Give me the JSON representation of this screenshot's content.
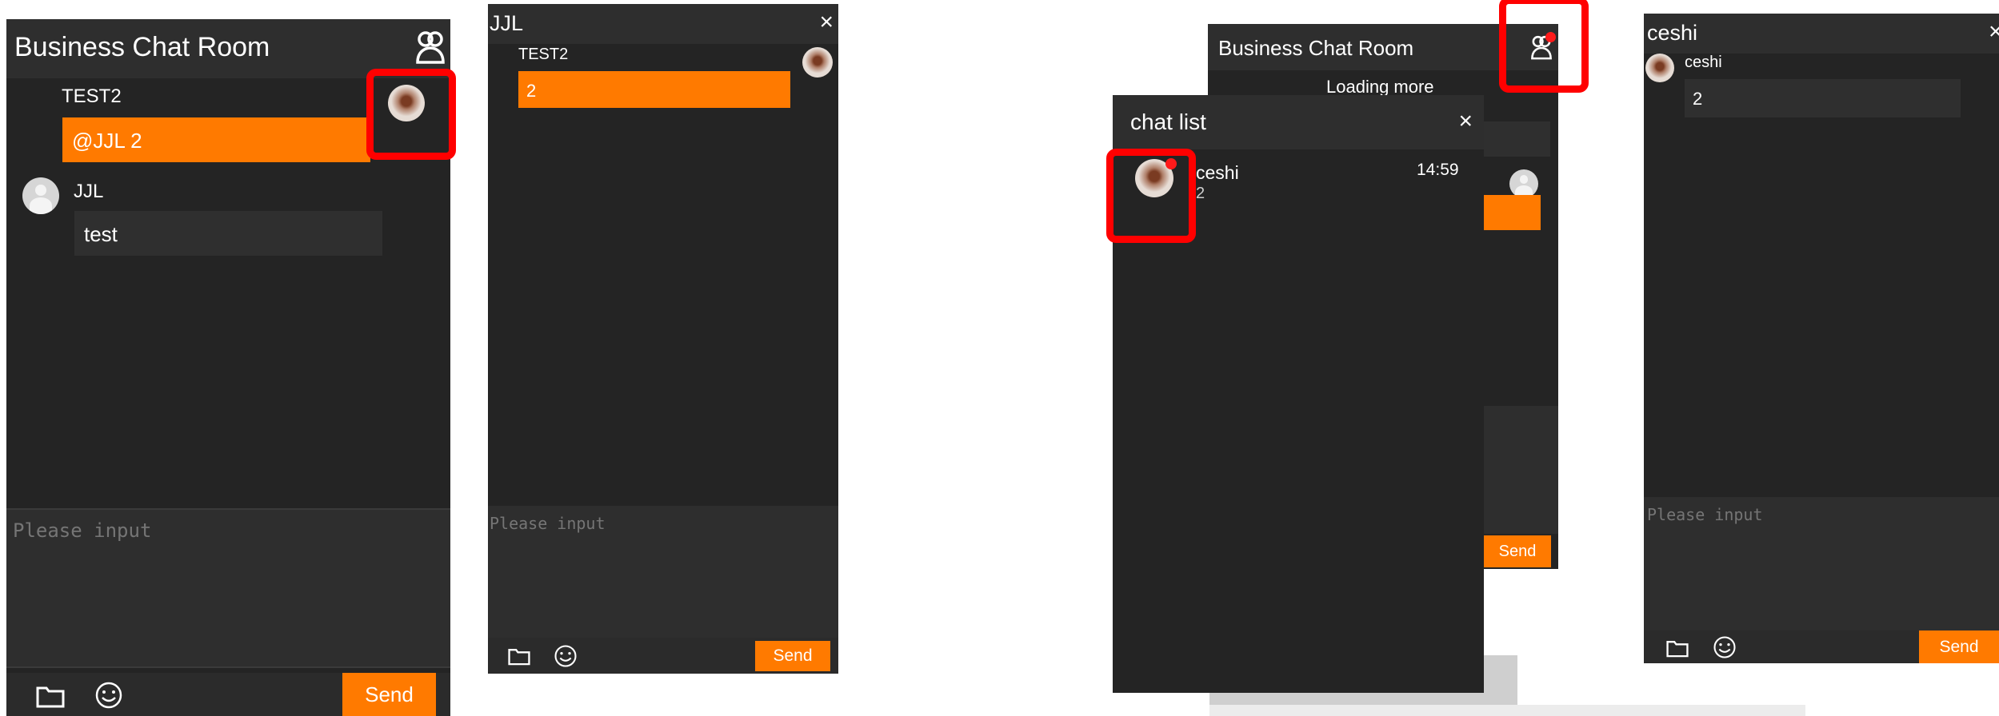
{
  "panel_a": {
    "title": "Business Chat Room",
    "messages": [
      {
        "user": "TEST2",
        "text": "@JJL 2"
      },
      {
        "user": "JJL",
        "text": "test"
      }
    ],
    "input_placeholder": "Please input",
    "send_label": "Send"
  },
  "panel_b": {
    "title": "JJL",
    "close": "×",
    "messages": [
      {
        "user": "TEST2",
        "text": "2"
      }
    ],
    "input_placeholder": "Please input",
    "send_label": "Send"
  },
  "panel_c": {
    "title": "Business Chat Room",
    "loading_text": "Loading more",
    "send_label": "Send",
    "chat_list": {
      "title": "chat list",
      "close": "×",
      "items": [
        {
          "name": "ceshi",
          "time": "14:59",
          "preview": "2"
        }
      ]
    }
  },
  "panel_d": {
    "title": "ceshi",
    "close": "×",
    "messages": [
      {
        "user": "ceshi",
        "text": "2"
      }
    ],
    "input_placeholder": "Please input",
    "send_label": "Send"
  },
  "colors": {
    "panel_bg": "#242424",
    "accent": "#ff7a00",
    "highlight": "#ff0000"
  },
  "icons": [
    "group-icon",
    "folder-icon",
    "smiley-icon",
    "close-icon",
    "avatar-icon"
  ]
}
